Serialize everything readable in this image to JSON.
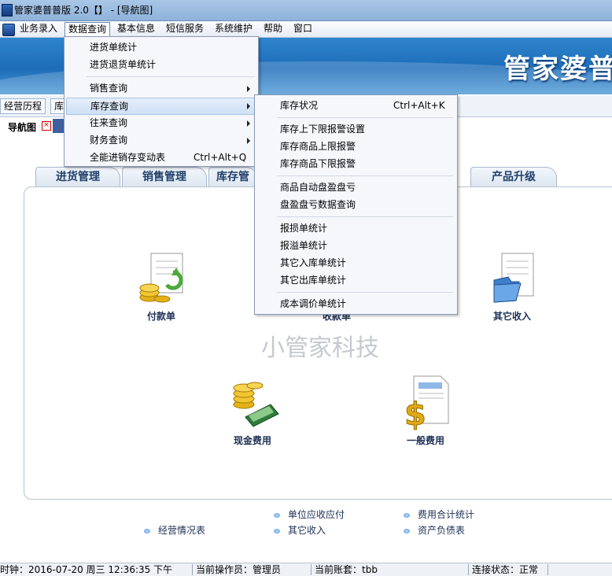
{
  "window": {
    "title": "管家婆普普版 2.0【】 - [导航图]"
  },
  "menubar": {
    "items": [
      "业务录入",
      "数据查询",
      "基本信息",
      "短信服务",
      "系统维护",
      "帮助",
      "窗口"
    ]
  },
  "banner": {
    "brand": "管家婆普"
  },
  "doc_tabs": [
    "经营历程",
    "库"
  ],
  "nav": {
    "label": "导航图",
    "close_glyph": "⊠"
  },
  "module_tabs": [
    "进货管理",
    "销售管理",
    "库存管",
    "产品升级"
  ],
  "icons": [
    {
      "label": "付款单",
      "icon": "coins-doc-icon"
    },
    {
      "label": "收款单",
      "icon": "receipt-icon"
    },
    {
      "label": "其它收入",
      "icon": "folder-doc-icon"
    },
    {
      "label": "现金费用",
      "icon": "cash-icon"
    },
    {
      "label": "一般费用",
      "icon": "dollar-doc-icon"
    }
  ],
  "watermark": "小管家科技",
  "links": [
    "单位应收应付",
    "费用合计统计",
    "经营情况表",
    "其它收入",
    "资产负债表"
  ],
  "status": [
    "时钟：2016-07-20 周三 12:36:35 下午",
    "当前操作员：管理员",
    "当前账套：tbb",
    "连接状态：正常"
  ],
  "data_menu": {
    "items": [
      {
        "label": "进货单统计",
        "shortcut": ""
      },
      {
        "label": "进货退货单统计",
        "shortcut": ""
      },
      {
        "label": "销售查询",
        "shortcut": ""
      },
      {
        "label": "库存查询",
        "shortcut": ""
      },
      {
        "label": "往来查询",
        "shortcut": ""
      },
      {
        "label": "财务查询",
        "shortcut": ""
      },
      {
        "label": "全能进销存变动表",
        "shortcut": "Ctrl+Alt+Q"
      }
    ]
  },
  "stock_menu": {
    "items": [
      {
        "label": "库存状况",
        "shortcut": "Ctrl+Alt+K"
      },
      {
        "label": "库存上下限报警设置",
        "shortcut": ""
      },
      {
        "label": "库存商品上限报警",
        "shortcut": ""
      },
      {
        "label": "库存商品下限报警",
        "shortcut": ""
      },
      {
        "label": "商品自动盘盈盘亏",
        "shortcut": ""
      },
      {
        "label": "盘盈盘亏数据查询",
        "shortcut": ""
      },
      {
        "label": "报损单统计",
        "shortcut": ""
      },
      {
        "label": "报溢单统计",
        "shortcut": ""
      },
      {
        "label": "其它入库单统计",
        "shortcut": ""
      },
      {
        "label": "其它出库单统计",
        "shortcut": ""
      },
      {
        "label": "成本调价单统计",
        "shortcut": ""
      }
    ]
  }
}
